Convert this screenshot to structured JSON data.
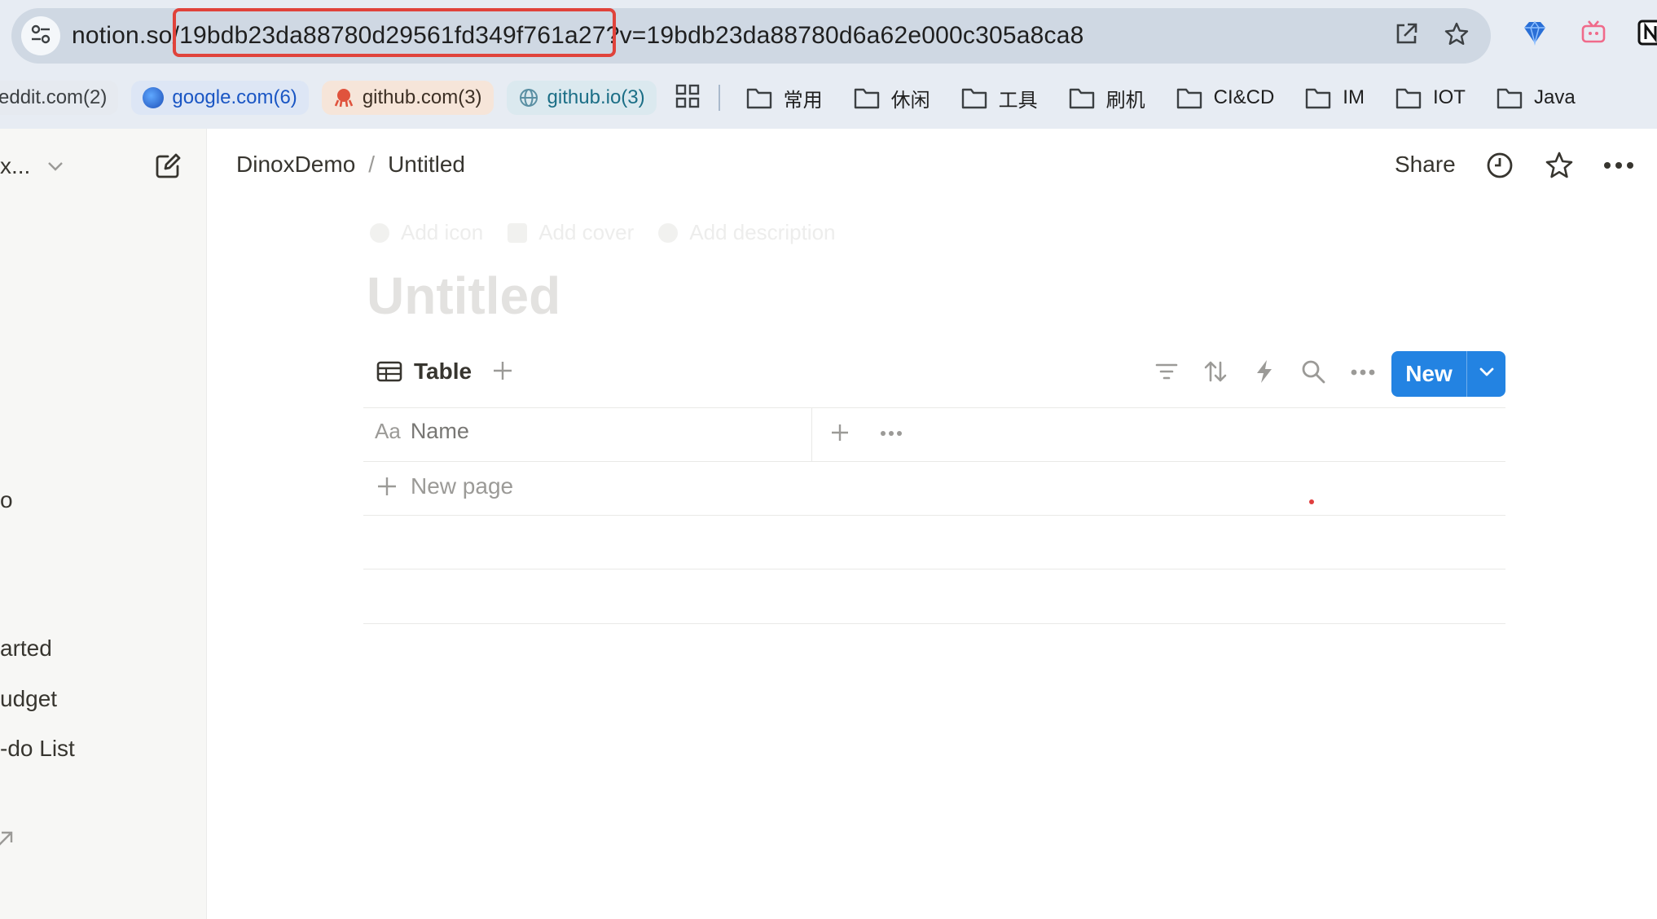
{
  "browser": {
    "url_host": "notion.so",
    "url_path": "/19bdb23da88780d29561fd349f761a27",
    "url_query": "?v=19bdb23da88780d6a62e000c305a8ca8",
    "bookmarks_chips": [
      {
        "label": "eddit.com(2)",
        "bg": "#e6eaf0",
        "fg": "#3c4043"
      },
      {
        "label": "google.com(6)",
        "bg": "#dde6f5",
        "fg": "#1a56c4"
      },
      {
        "label": "github.com(3)",
        "bg": "#f6e5d9",
        "fg": "#3c2f24"
      },
      {
        "label": "github.io(3)",
        "bg": "#dbe9ef",
        "fg": "#1b6e86"
      }
    ],
    "folders": [
      "常用",
      "休闲",
      "工具",
      "刷机",
      "CI&CD",
      "IM",
      "IOT",
      "Java"
    ]
  },
  "sidebar": {
    "workspace_label": "x...",
    "item_o": "o",
    "item_started": "arted",
    "item_budget": "udget",
    "item_todo": "-do List"
  },
  "topbar": {
    "breadcrumb_parent": "DinoxDemo",
    "breadcrumb_sep": "/",
    "breadcrumb_current": "Untitled",
    "share_label": "Share"
  },
  "page": {
    "add_icon": "Add icon",
    "add_cover": "Add cover",
    "add_description": "Add description",
    "title": "Untitled"
  },
  "database": {
    "view_label": "Table",
    "new_button_label": "New",
    "name_column_prefix": "Aa",
    "name_column": "Name",
    "new_page_label": "New page"
  },
  "colors": {
    "accent": "#2383e2",
    "highlight": "#e0433b"
  }
}
